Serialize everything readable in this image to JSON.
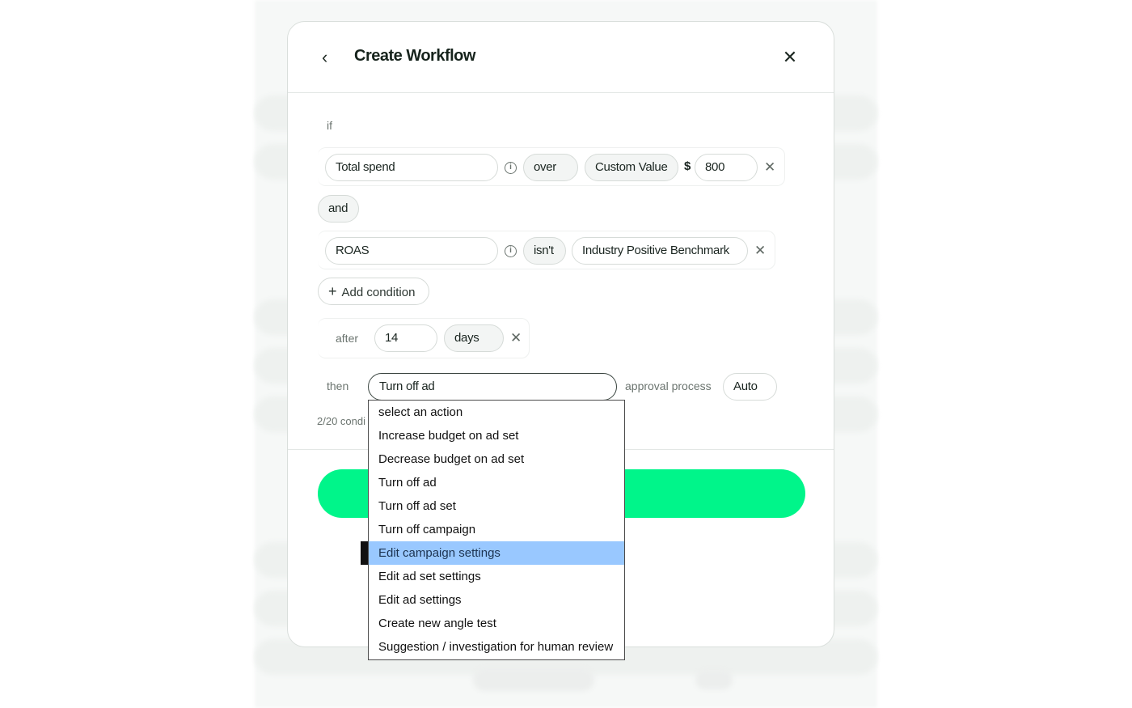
{
  "modal": {
    "title": "Create Workflow",
    "if_label": "if",
    "conditions": [
      {
        "metric": "Total spend",
        "operator": "over",
        "value_type": "Custom Value",
        "currency": "$",
        "value": "800"
      },
      {
        "metric": "ROAS",
        "operator": "isn't",
        "value_type": "Industry Positive Benchmark"
      }
    ],
    "joiner": "and",
    "add_condition_label": "Add condition",
    "after": {
      "label": "after",
      "value": "14",
      "unit": "days"
    },
    "then": {
      "label": "then",
      "action": "Turn off ad",
      "approval_label": "approval process",
      "approval_value": "Auto"
    },
    "condition_count": "2/20 condi"
  },
  "dropdown": {
    "options": [
      "select an action",
      "Increase budget on ad set",
      "Decrease budget on ad set",
      "Turn off ad",
      "Turn off ad set",
      "Turn off campaign",
      "Edit campaign settings",
      "Edit ad set settings",
      "Edit ad settings",
      "Create new angle test",
      "Suggestion / investigation for human review"
    ],
    "highlighted": "Edit campaign settings"
  },
  "colors": {
    "accent": "#00f58a",
    "highlight": "#99c8ff"
  }
}
